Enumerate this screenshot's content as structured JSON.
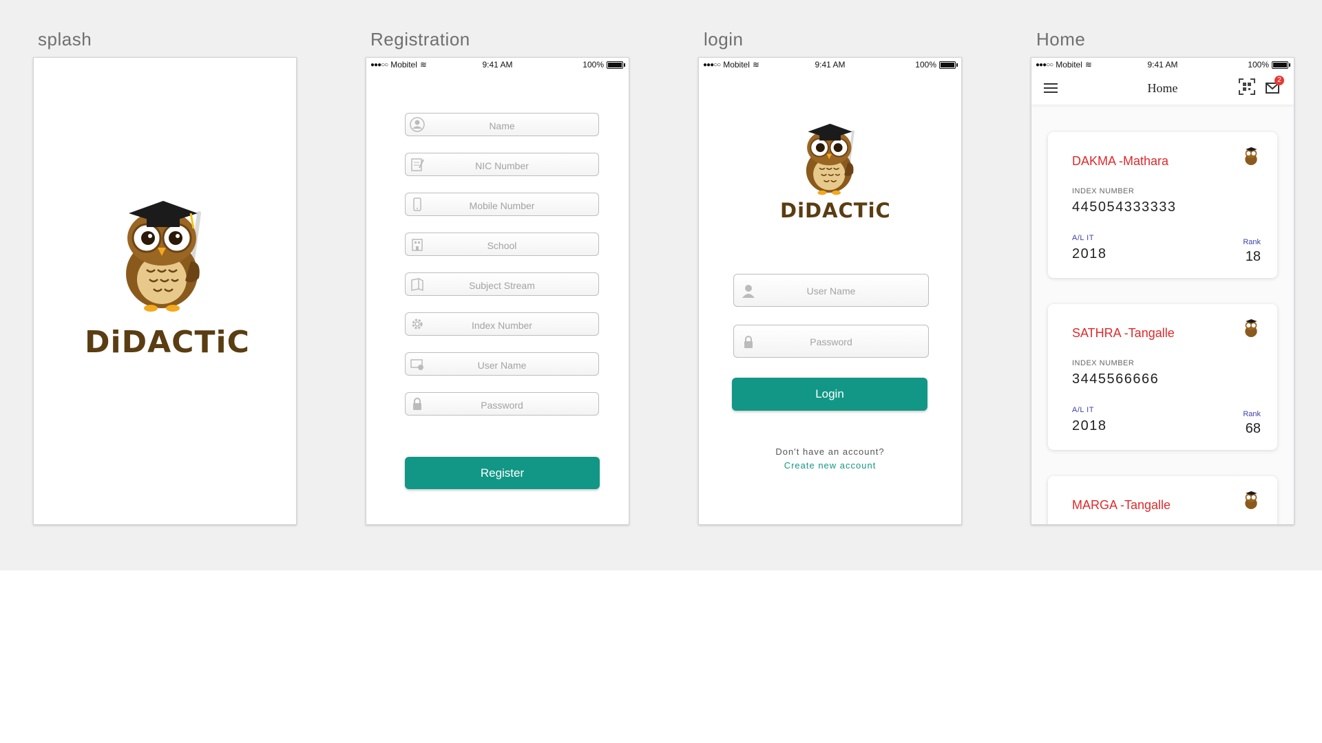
{
  "artboards": {
    "splash": "splash",
    "registration": "Registration",
    "login": "login",
    "home": "Home"
  },
  "statusbar": {
    "carrier": "Mobitel",
    "time": "9:41 AM",
    "battery": "100%"
  },
  "brand": {
    "name": "DiDACTiC"
  },
  "registration": {
    "fields": [
      {
        "placeholder": "Name",
        "icon": "user-circle-icon"
      },
      {
        "placeholder": "NIC Number",
        "icon": "id-card-icon"
      },
      {
        "placeholder": "Mobile Number",
        "icon": "mobile-phone-icon"
      },
      {
        "placeholder": "School",
        "icon": "school-building-icon"
      },
      {
        "placeholder": "Subject Stream",
        "icon": "book-icon"
      },
      {
        "placeholder": "Index Number",
        "icon": "gear-icon"
      },
      {
        "placeholder": "User Name",
        "icon": "user-card-icon"
      },
      {
        "placeholder": "Password",
        "icon": "lock-icon"
      }
    ],
    "register_label": "Register"
  },
  "login": {
    "username_placeholder": "User Name",
    "password_placeholder": "Password",
    "login_label": "Login",
    "no_account_text": "Don't have an account?",
    "create_link": "Create new account"
  },
  "home": {
    "title": "Home",
    "mail_badge": "2",
    "cards": [
      {
        "title": "DAKMA -Mathara",
        "index_label": "INDEX NUMBER",
        "index_number": "445054333333",
        "stream": "A/L IT",
        "year": "2018",
        "rank_label": "Rank",
        "rank": "18"
      },
      {
        "title": "SATHRA -Tangalle",
        "index_label": "INDEX NUMBER",
        "index_number": "3445566666",
        "stream": "A/L IT",
        "year": "2018",
        "rank_label": "Rank",
        "rank": "68"
      },
      {
        "title": "MARGA -Tangalle"
      }
    ]
  },
  "colors": {
    "primary": "#129786",
    "card_title": "#e0292b",
    "brand": "#5a3d12",
    "badge": "#e53935"
  }
}
